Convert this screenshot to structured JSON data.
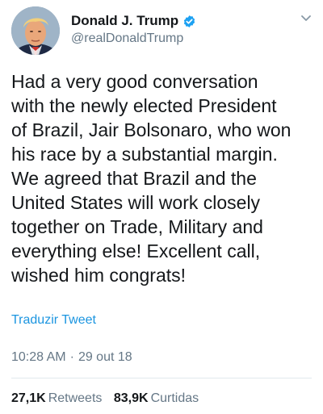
{
  "tweet": {
    "author": {
      "display_name": "Donald J. Trump",
      "handle": "@realDonaldTrump",
      "verified": true
    },
    "text": "Had a very good conversation\nwith the newly elected President\nof Brazil, Jair Bolsonaro, who won\nhis race by a substantial margin.\nWe agreed that Brazil and the\nUnited States will work closely\ntogether on Trade, Military and\neverything else! Excellent call,\nwished him congrats!",
    "translate_label": "Traduzir Tweet",
    "time": "10:28 AM",
    "separator": "·",
    "date": "29 out 18",
    "retweets": {
      "count": "27,1K",
      "label": "Retweets"
    },
    "likes": {
      "count": "83,9K",
      "label": "Curtidas"
    }
  },
  "icons": {
    "verified": "verified-badge-icon",
    "menu": "chevron-down-icon"
  },
  "colors": {
    "link": "#1b95e0",
    "secondary_text": "#657786",
    "primary_text": "#14171a",
    "verified_badge": "#1da1f2",
    "divider": "#e1e8ed"
  }
}
